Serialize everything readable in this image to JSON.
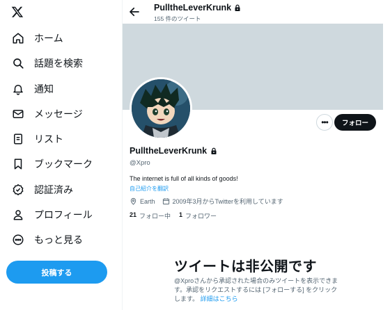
{
  "nav": {
    "items": [
      {
        "key": "home",
        "label": "ホーム",
        "icon": "home-icon"
      },
      {
        "key": "explore",
        "label": "話題を検索",
        "icon": "search-icon"
      },
      {
        "key": "notifications",
        "label": "通知",
        "icon": "bell-icon"
      },
      {
        "key": "messages",
        "label": "メッセージ",
        "icon": "envelope-icon"
      },
      {
        "key": "lists",
        "label": "リスト",
        "icon": "list-icon"
      },
      {
        "key": "bookmarks",
        "label": "ブックマーク",
        "icon": "bookmark-icon"
      },
      {
        "key": "verified",
        "label": "認証済み",
        "icon": "verified-icon"
      },
      {
        "key": "profile",
        "label": "プロフィール",
        "icon": "person-icon"
      },
      {
        "key": "more",
        "label": "もっと見る",
        "icon": "more-circle-icon"
      }
    ],
    "post_label": "投稿する"
  },
  "header": {
    "name": "PulltheLeverKrunk",
    "post_count": "155 件のツイート"
  },
  "profile": {
    "name": "PulltheLeverKrunk",
    "handle": "@Xpro",
    "bio": "The internet is full of all kinds of goods!",
    "translate_label": "自己紹介を翻訳",
    "location": "Earth",
    "joined": "2009年3月からTwitterを利用しています",
    "following_count": "21",
    "following_label": "フォロー中",
    "followers_count": "1",
    "followers_label": "フォロワー",
    "follow_button": "フォロー",
    "more_button": "•••"
  },
  "private_notice": {
    "title": "ツイートは非公開です",
    "description": "@Xproさんから承認された場合のみツイートを表示できます。承認をリクエストするには [フォローする] をクリックします。",
    "link": "詳細はこちら"
  },
  "colors": {
    "accent": "#1d9bf0",
    "banner": "#cfd9de",
    "text_secondary": "#536471",
    "button_dark": "#0f1419"
  }
}
